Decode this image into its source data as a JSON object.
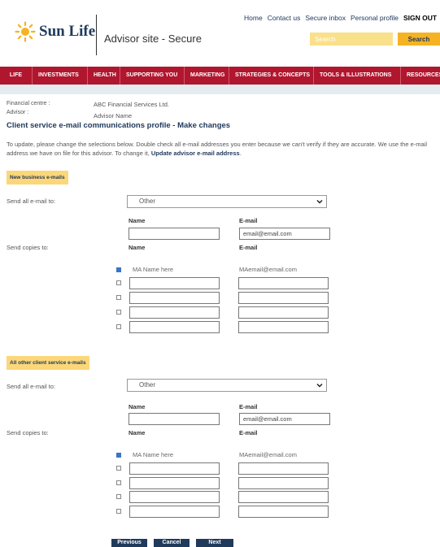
{
  "header": {
    "logo_text": "Sun Life",
    "site_title": "Advisor site - Secure",
    "links": [
      "Home",
      "Contact us",
      "Secure inbox",
      "Personal profile"
    ],
    "signout": "SIGN OUT",
    "search_placeholder": "Search",
    "search_button": "Search"
  },
  "nav": [
    "LIFE",
    "INVESTMENTS",
    "HEALTH",
    "SUPPORTING YOU",
    "MARKETING",
    "STRATEGIES & CONCEPTS",
    "TOOLS & ILLUSTRATIONS",
    "RESOURCES"
  ],
  "info": {
    "fc_label": "Financial centre :",
    "fc_value": "ABC Financial Services Ltd.",
    "advisor_label": "Advisor :",
    "advisor_value": "Advisor Name"
  },
  "page_title": "Client service e-mail communications profile - Make changes",
  "intro": {
    "text": "To update, please change the selections below. Double check all e-mail addresses you enter because we can't verify if they are accurate. We use the e-mail address we have on file for this advisor. To change it,",
    "link": "Update advisor e-mail address",
    "suffix": "."
  },
  "sections": [
    {
      "title": "New business e-mails",
      "send_all_label": "Send all e-mail to:",
      "send_all_value": "Other",
      "name_header": "Name",
      "email_header": "E-mail",
      "name_value": "",
      "email_value": "email@email.com",
      "copies_label": "Send copies to:",
      "copies_name_header": "Name",
      "copies_email_header": "E-mail",
      "ma_name": "MA Name here",
      "ma_email": "MAemail@email.com"
    },
    {
      "title": "All other client service e-mails",
      "send_all_label": "Send all e-mail to:",
      "send_all_value": "Other",
      "name_header": "Name",
      "email_header": "E-mail",
      "name_value": "",
      "email_value": "email@email.com",
      "copies_label": "Send copies to:",
      "copies_name_header": "Name",
      "copies_email_header": "E-mail",
      "ma_name": "MA Name here",
      "ma_email": "MAemail@email.com"
    }
  ],
  "buttons": {
    "previous": "Previous",
    "cancel": "Cancel",
    "next": "Next"
  },
  "colors": {
    "brand_navy": "#203a5c",
    "nav_red": "#b1162f",
    "brand_yellow": "#f5b323",
    "section_yellow": "#fcd779",
    "checkbox_blue": "#3a75c4"
  }
}
